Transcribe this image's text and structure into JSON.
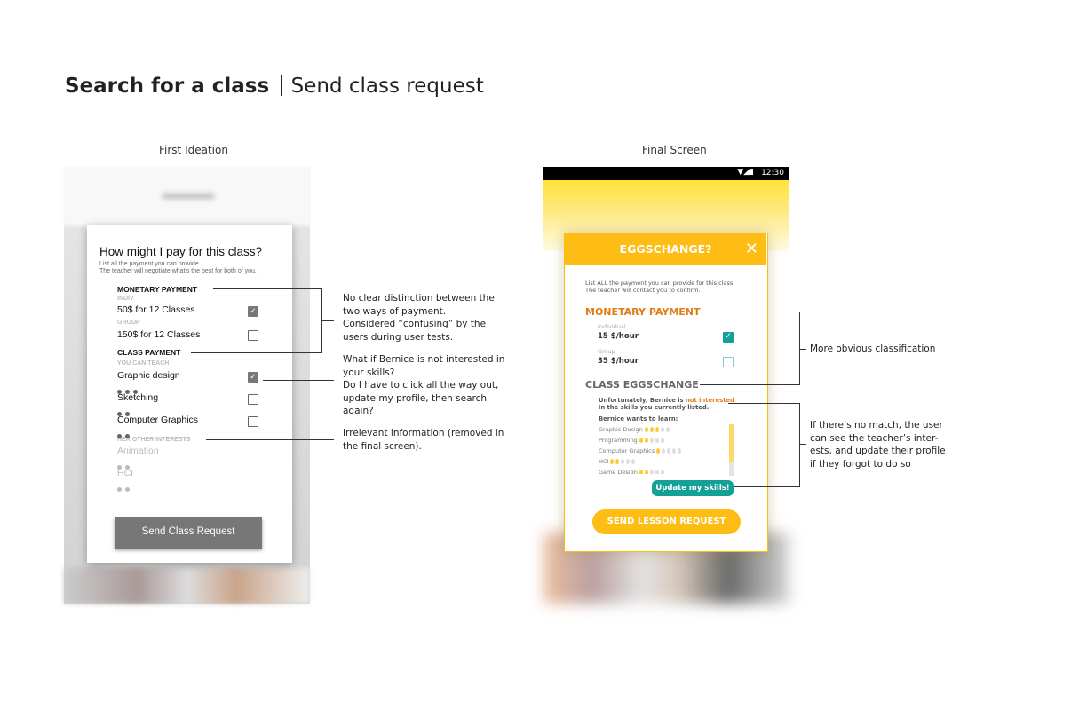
{
  "header": {
    "title": "Search for a class",
    "subtitle": "Send class request"
  },
  "first": {
    "caption": "First Ideation",
    "question": "How might I pay for this class?",
    "sub1": "List all the payment you can provide.",
    "sub2": "The teacher will negotiate what's the best for both of you.",
    "monetary": "MONETARY PAYMENT",
    "indiv": "INDIV",
    "indiv_value": "50$ for 12 Classes",
    "indiv_checked": true,
    "group": "GROUP",
    "group_value": "150$ for 12 Classes",
    "group_checked": false,
    "class_payment": "CLASS PAYMENT",
    "you_can_teach": "YOU CAN TEACH",
    "skills": [
      {
        "name": "Graphic design",
        "level": 3,
        "checked": true
      },
      {
        "name": "Sketching",
        "level": 2,
        "checked": false
      },
      {
        "name": "Computer Graphics",
        "level": 2,
        "checked": false
      }
    ],
    "other": "HER OTHER INTERESTS",
    "interests": [
      {
        "name": "Animation",
        "level": 2
      },
      {
        "name": "HCI",
        "level": 2
      }
    ],
    "button": "Send Class Request"
  },
  "final": {
    "caption": "Final Screen",
    "time": "12:30",
    "title": "EGGSCHANGE?",
    "sub1": "List ALL the payment you can provide for this class.",
    "sub2": "The teacher will contact you to confirm.",
    "monetary": "MONETARY PAYMENT",
    "individual": "Individual",
    "individual_value": "15 $/hour",
    "individual_checked": true,
    "group": "Group",
    "group_value": "35 $/hour",
    "group_checked": false,
    "class": "CLASS EGGSCHANGE",
    "msg_a": "Unfortunately, Bernice is ",
    "msg_hl": "not interested",
    "msg_b": "in the skills you currently listed.",
    "wants": "Bernice wants to learn:",
    "learn": [
      {
        "name": "Graphic Design",
        "level": 3
      },
      {
        "name": "Programming",
        "level": 2
      },
      {
        "name": "Computer Graphics",
        "level": 1
      },
      {
        "name": "HCI",
        "level": 2
      },
      {
        "name": "Game Design",
        "level": 2
      }
    ],
    "update": "Update my skills!",
    "send": "SEND LESSON REQUEST",
    "colors": {
      "accent": "#fdbd15",
      "orange": "#e07d14",
      "teal": "#14a096"
    }
  },
  "notes": {
    "n1": [
      "No clear distinction between the",
      "two ways of payment.",
      "Considered “confusing” by the",
      "users during user tests."
    ],
    "n2": [
      "What if Bernice is not interested in",
      "your skills?",
      "Do I have to click all the way out,",
      "update my profile, then search",
      "again?"
    ],
    "n3": [
      "Irrelevant information (removed in",
      "the final screen)."
    ],
    "r1": [
      "More obvious classification"
    ],
    "r2": [
      "If there’s no match, the user",
      "can see the teacher’s inter-",
      "ests, and update their profile",
      "if they forgot to do so"
    ]
  }
}
